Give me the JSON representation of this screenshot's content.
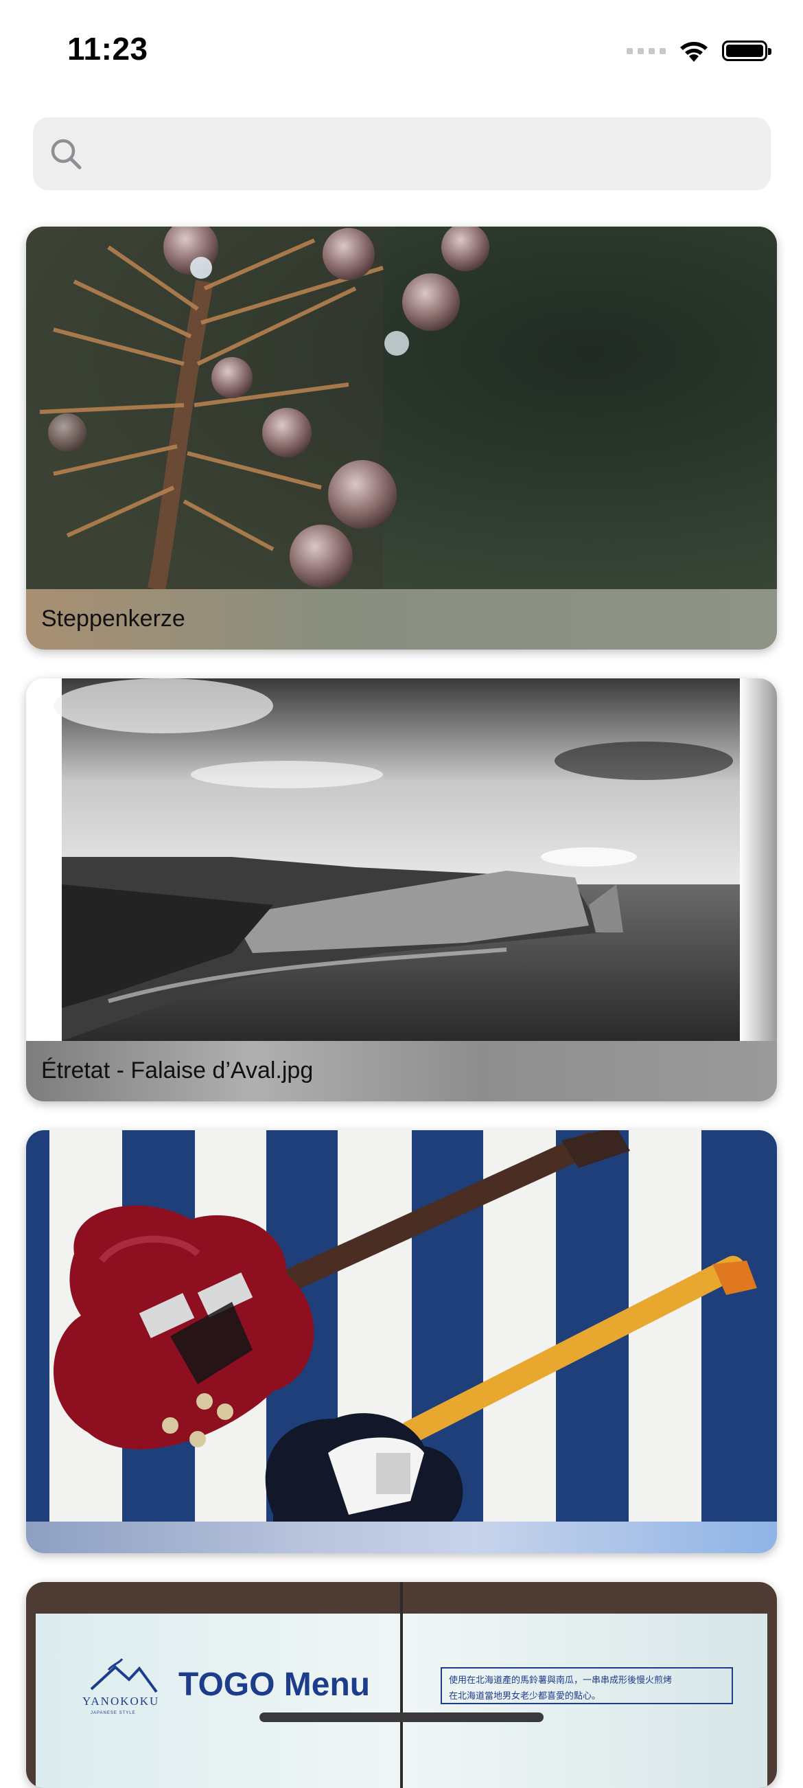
{
  "status_bar": {
    "time": "11:23",
    "icons": [
      "cellular-signal-icon",
      "wifi-icon",
      "battery-icon"
    ]
  },
  "search": {
    "placeholder": "",
    "value": ""
  },
  "cards": [
    {
      "caption": "Steppenkerze",
      "image": "plant-with-water-droplets-photo"
    },
    {
      "caption": "Étretat - Falaise d’Aval.jpg",
      "image": "black-and-white-coastal-cliff-photo"
    },
    {
      "caption": "",
      "image": "two-electric-guitars-on-striped-rug-photo"
    },
    {
      "caption": "",
      "image": "restaurant-menu-sign-photo",
      "sign": {
        "brand": "YANOKOKU",
        "brand_sub": "JAPANESE STYLE",
        "title": "TOGO Menu",
        "notice_line1": "使用在北海道產的馬鈴薯與南瓜，一串串成形後慢火煎烤",
        "notice_line2": "在北海道當地男女老少都喜愛的點心。"
      }
    }
  ],
  "colors": {
    "search_background": "#eeeeef",
    "menu_title_blue": "#1e3c8c"
  }
}
